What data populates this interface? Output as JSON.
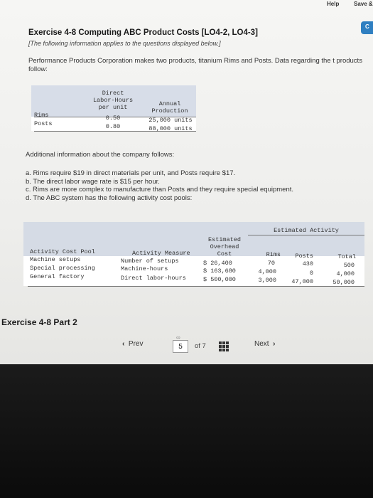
{
  "topbar": {
    "help": "Help",
    "save": "Save &"
  },
  "side_button": "C",
  "exercise": {
    "title": "Exercise 4-8 Computing ABC Product Costs [LO4-2, LO4-3]",
    "note": "[The following information applies to the questions displayed below.]",
    "intro": "Performance Products Corporation makes two products, titanium Rims and Posts. Data regarding the t products follow:"
  },
  "table1": {
    "headers": {
      "dlh_1": "Direct",
      "dlh_2": "Labor-Hours",
      "dlh_3": "per unit",
      "ap_1": "Annual",
      "ap_2": "Production"
    },
    "rows": [
      {
        "name": "Rims",
        "dlh": "0.50",
        "production": "25,000 units"
      },
      {
        "name": "Posts",
        "dlh": "0.80",
        "production": "88,000 units"
      }
    ]
  },
  "additional": {
    "heading": "Additional information about the company follows:",
    "items": [
      "a. Rims require $19 in direct materials per unit, and Posts require $17.",
      "b. The direct labor wage rate is $15 per hour.",
      "c. Rims are more complex to manufacture than Posts and they require special equipment.",
      "d. The ABC system has the following activity cost pools:"
    ]
  },
  "table2": {
    "headers": {
      "estimated_activity": "Estimated Activity",
      "overhead_1": "Estimated",
      "overhead_2": "Overhead",
      "overhead_3": "Cost",
      "pool": "Activity Cost Pool",
      "measure": "Activity Measure",
      "rims": "Rims",
      "posts": "Posts",
      "total": "Total"
    },
    "rows": [
      {
        "pool": "Machine setups",
        "measure": "Number of setups",
        "cost": "$ 26,400",
        "rims": "70",
        "posts": "430",
        "total": "500"
      },
      {
        "pool": "Special processing",
        "measure": "Machine-hours",
        "cost": "$ 163,680",
        "rims": "4,000",
        "posts": "0",
        "total": "4,000"
      },
      {
        "pool": "General factory",
        "measure": "Direct labor-hours",
        "cost": "$ 500,000",
        "rims": "3,000",
        "posts": "47,000",
        "total": "50,000"
      }
    ]
  },
  "part_heading": "Exercise 4-8 Part 2",
  "pagination": {
    "prev": "Prev",
    "current": "5",
    "of": "of 7",
    "next": "Next"
  }
}
